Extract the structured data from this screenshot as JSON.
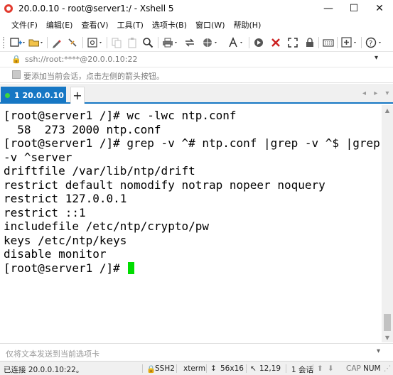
{
  "window": {
    "title": "20.0.0.10 - root@server1:/ - Xshell 5",
    "minimize_glyph": "—",
    "maximize_glyph": "☐",
    "close_glyph": "✕"
  },
  "menu": [
    {
      "label": "文件(F)"
    },
    {
      "label": "编辑(E)"
    },
    {
      "label": "查看(V)"
    },
    {
      "label": "工具(T)"
    },
    {
      "label": "选项卡(B)"
    },
    {
      "label": "窗口(W)"
    },
    {
      "label": "帮助(H)"
    }
  ],
  "toolbar": {
    "icons": [
      "new-session-icon",
      "open-folder-icon",
      "pen-icon",
      "connect-icon",
      "properties-icon",
      "copy-icon",
      "paste-icon",
      "find-icon",
      "print-icon",
      "transfer-icon",
      "globe-icon",
      "font-icon",
      "script-icon",
      "xftp-icon",
      "fullscreen-icon",
      "lock-icon",
      "keyboard-icon",
      "add-icon",
      "help-icon"
    ]
  },
  "address": {
    "text": "ssh://root:****@20.0.0.10:22"
  },
  "hint": {
    "text": "要添加当前会话，点击左侧的箭头按钮。"
  },
  "tabs": {
    "active_label": "1 20.0.0.10",
    "add_label": "+",
    "nav_arrows": "◂ ▸ ▾"
  },
  "terminal": {
    "lines": [
      "[root@server1 /]# wc -lwc ntp.conf",
      "  58  273 2000 ntp.conf",
      "[root@server1 /]# grep -v ^# ntp.conf |grep -v ^$ |grep",
      "-v ^server",
      "driftfile /var/lib/ntp/drift",
      "restrict default nomodify notrap nopeer noquery",
      "restrict 127.0.0.1",
      "restrict ::1",
      "includefile /etc/ntp/crypto/pw",
      "keys /etc/ntp/keys",
      "disable monitor"
    ],
    "prompt": "[root@server1 /]# ",
    "cursor_color": "#00dd00"
  },
  "compose": {
    "placeholder": "仅将文本发送到当前选项卡"
  },
  "status": {
    "connection": "已连接 20.0.0.10:22。",
    "protocol": "SSH2",
    "term": "xterm",
    "size": "56x16",
    "position": "12,19",
    "sessions": "1 会话",
    "caps": "CAP",
    "num": "NUM"
  },
  "colors": {
    "tab_accent": "#1677c4",
    "tab_dot": "#3ed63e"
  }
}
